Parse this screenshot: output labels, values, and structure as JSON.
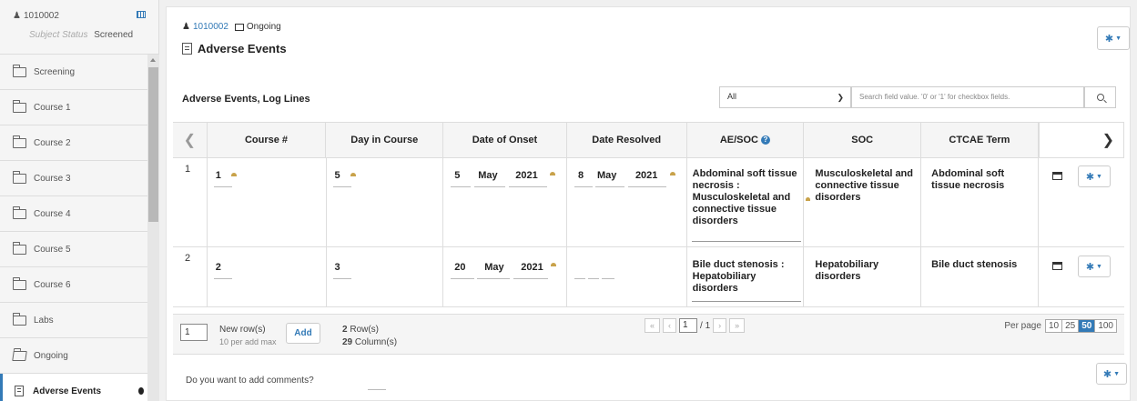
{
  "sidebar": {
    "subject_id": "1010002",
    "status_label": "Subject Status",
    "status_value": "Screened",
    "items": [
      {
        "label": "Screening"
      },
      {
        "label": "Course 1"
      },
      {
        "label": "Course 2"
      },
      {
        "label": "Course 3"
      },
      {
        "label": "Course 4"
      },
      {
        "label": "Course 5"
      },
      {
        "label": "Course 6"
      },
      {
        "label": "Labs"
      },
      {
        "label": "Ongoing"
      },
      {
        "label": "Adverse Events"
      }
    ]
  },
  "header": {
    "subject_id": "1010002",
    "folder": "Ongoing",
    "title": "Adverse Events"
  },
  "log": {
    "title": "Adverse Events, Log Lines",
    "filter_value": "All",
    "search_placeholder": "Search field value. '0' or '1' for checkbox fields."
  },
  "table": {
    "columns": [
      "Course #",
      "Day in Course",
      "Date of Onset",
      "Date Resolved",
      "AE/SOC",
      "SOC",
      "CTCAE Term"
    ],
    "rows": [
      {
        "num": "1",
        "course": "1",
        "day": "5",
        "onset_day": "5",
        "onset_month": "May",
        "onset_year": "2021",
        "resolved_day": "8",
        "resolved_month": "May",
        "resolved_year": "2021",
        "ae_soc": "Abdominal soft tissue necrosis : Musculoskeletal and connective tissue disorders",
        "soc": "Musculoskeletal and connective tissue disorders",
        "ctcae": "Abdominal soft tissue necrosis"
      },
      {
        "num": "2",
        "course": "2",
        "day": "3",
        "onset_day": "20",
        "onset_month": "May",
        "onset_year": "2021",
        "resolved_day": "",
        "resolved_month": "",
        "resolved_year": "",
        "ae_soc": "Bile duct stenosis : Hepatobiliary disorders",
        "soc": "Hepatobiliary disorders",
        "ctcae": "Bile duct stenosis"
      }
    ]
  },
  "footer": {
    "new_rows_value": "1",
    "new_rows_label": "New row(s)",
    "per_add_max": "10 per add max",
    "add_label": "Add",
    "row_count": "2",
    "row_count_label": "Row(s)",
    "col_count": "29",
    "col_count_label": "Column(s)",
    "page_value": "1",
    "page_total": "/ 1",
    "per_page_label": "Per page",
    "per_page_options": [
      "10",
      "25",
      "50",
      "100"
    ],
    "per_page_selected": "50"
  },
  "comments": {
    "question": "Do you want to add comments?"
  },
  "colors": {
    "accent": "#337ab7",
    "marker": "#c8a24a"
  }
}
